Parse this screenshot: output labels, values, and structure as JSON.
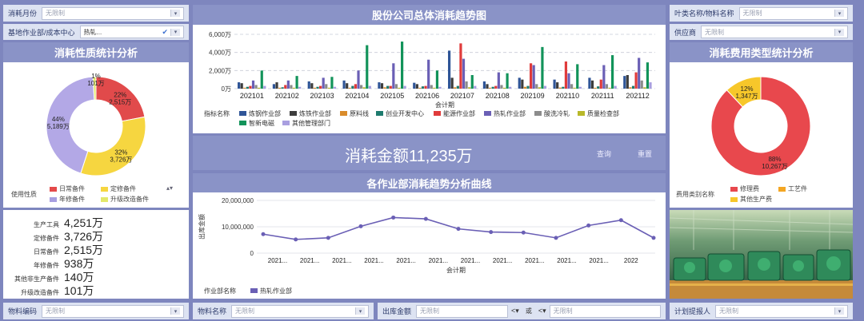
{
  "colors": {
    "accent": "#8a93c7",
    "background": "#7e86be"
  },
  "filters": {
    "consume_month": {
      "label": "消耗月份",
      "value": "无限制"
    },
    "base_unit": {
      "label": "基地作业部/成本中心",
      "value": "热轧..."
    },
    "material_name": {
      "label": "叶类名称/物料名称",
      "value": "无限制"
    },
    "supplier": {
      "label": "供应商",
      "value": "无限制"
    },
    "material_code": {
      "label": "物料编码",
      "value": "无限制"
    },
    "material_desc": {
      "label": "物料名称",
      "value": "无限制"
    },
    "issue_amount": {
      "label": "出库金额",
      "value": "无限制",
      "op1": "<",
      "mid": "或",
      "op2": "<",
      "value2": "无限制"
    },
    "planner": {
      "label": "计划提报人",
      "value": "无限制"
    }
  },
  "left_panel": {
    "title": "消耗性质统计分析",
    "legend_label": "使用性质",
    "legend": [
      {
        "name": "日常备件",
        "color": "#e44a4a"
      },
      {
        "name": "定修备件",
        "color": "#f6d640"
      },
      {
        "name": "年修备件",
        "color": "#a79ee0"
      },
      {
        "name": "升级改造备件",
        "color": "#e3e86a"
      }
    ]
  },
  "donut_left": [
    {
      "name": "日常备件",
      "pct": "22%",
      "value": "2,515万",
      "share": 0.22,
      "color": "#e14a4b"
    },
    {
      "name": "定修备件",
      "pct": "32%",
      "value": "3,726万",
      "share": 0.33,
      "color": "#f6d640"
    },
    {
      "name": "年修备件",
      "pct": "44%",
      "value": "5,189万",
      "share": 0.44,
      "color": "#b3a8e6"
    },
    {
      "name": "升级改造备件",
      "pct": "1%",
      "value": "101万",
      "share": 0.01,
      "color": "#e3e86a"
    }
  ],
  "stats": [
    {
      "label": "生产工具",
      "value": "4,251万"
    },
    {
      "label": "定修备件",
      "value": "3,726万"
    },
    {
      "label": "日常备件",
      "value": "2,515万"
    },
    {
      "label": "年修备件",
      "value": "938万"
    },
    {
      "label": "其他非生产备件",
      "value": "140万"
    },
    {
      "label": "升级改造备件",
      "value": "101万"
    }
  ],
  "center_top": {
    "title": "股份公司总体消耗趋势图",
    "xlabel": "会计期",
    "legend_label": "指标名称"
  },
  "chart_data": [
    {
      "type": "bar",
      "title": "股份公司总体消耗趋势图",
      "xlabel": "会计期",
      "ylabel": "",
      "y_ticks": [
        "6,000万",
        "4,000万",
        "2,000万",
        "0万"
      ],
      "ylim": [
        0,
        6000
      ],
      "categories": [
        "202101",
        "202102",
        "202103",
        "202104",
        "202105",
        "202106",
        "202107",
        "202108",
        "202109",
        "202110",
        "202111",
        "202112"
      ],
      "series": [
        {
          "name": "炼钢作业部",
          "color": "#2f5597",
          "values": [
            700,
            500,
            800,
            900,
            700,
            650,
            4200,
            800,
            1200,
            1000,
            1200,
            1400
          ]
        },
        {
          "name": "炼铁作业部",
          "color": "#3d3d3d",
          "values": [
            600,
            700,
            600,
            600,
            600,
            500,
            1200,
            500,
            1000,
            700,
            900,
            1500
          ]
        },
        {
          "name": "原料线",
          "color": "#d98b2b",
          "values": [
            100,
            100,
            100,
            100,
            150,
            100,
            150,
            100,
            200,
            120,
            100,
            150
          ]
        },
        {
          "name": "创业开发中心",
          "color": "#1e7b6e",
          "values": [
            200,
            150,
            200,
            300,
            300,
            250,
            300,
            200,
            300,
            200,
            250,
            300
          ]
        },
        {
          "name": "能源作业部",
          "color": "#e03b3b",
          "values": [
            300,
            400,
            300,
            500,
            300,
            300,
            5000,
            300,
            2800,
            3000,
            1000,
            1800
          ]
        },
        {
          "name": "热轧作业部",
          "color": "#6a5fb5",
          "values": [
            900,
            900,
            1200,
            2000,
            2800,
            3200,
            3300,
            1800,
            2600,
            1700,
            2600,
            3400
          ]
        },
        {
          "name": "酸洗冷轧",
          "color": "#8c8c8c",
          "values": [
            400,
            400,
            500,
            400,
            500,
            400,
            800,
            400,
            500,
            500,
            500,
            900
          ]
        },
        {
          "name": "质量检查部",
          "color": "#b8b82a",
          "values": [
            100,
            100,
            100,
            150,
            100,
            100,
            150,
            100,
            150,
            100,
            100,
            150
          ]
        },
        {
          "name": "智新电磁",
          "color": "#12935a",
          "values": [
            2000,
            1400,
            1300,
            4800,
            5200,
            2000,
            1500,
            1700,
            4600,
            2700,
            3700,
            2900
          ]
        },
        {
          "name": "其他管理部门",
          "color": "#a99fe0",
          "values": [
            300,
            200,
            200,
            300,
            300,
            200,
            300,
            200,
            300,
            200,
            300,
            700
          ]
        }
      ]
    },
    {
      "type": "line",
      "title": "各作业部消耗趋势分析曲线",
      "xlabel": "会计期",
      "ylabel": "出库金额",
      "y_ticks": [
        "20,000,000",
        "10,000,000",
        "0"
      ],
      "ylim": [
        0,
        20000000
      ],
      "categories": [
        "2021...",
        "2021...",
        "2021...",
        "2021...",
        "2021...",
        "2021...",
        "2021...",
        "2021...",
        "2021...",
        "2021...",
        "2021...",
        "2022"
      ],
      "series": [
        {
          "name": "热轧作业部",
          "color": "#6a5fb5",
          "values": [
            7200000,
            5200000,
            5800000,
            10200000,
            13500000,
            13000000,
            9200000,
            8000000,
            7800000,
            5800000,
            10500000,
            12500000,
            5800000
          ]
        }
      ]
    },
    {
      "type": "pie",
      "title": "消耗费用类型统计分析",
      "legend_label": "费用类别名称",
      "slices": [
        {
          "name": "修理费",
          "pct": "88%",
          "value": "10,267万",
          "share": 0.88,
          "color": "#e8484d"
        },
        {
          "name": "工艺件",
          "pct": "",
          "value": "",
          "share": 0.0,
          "color": "#f4a623"
        },
        {
          "name": "其他生产费",
          "pct": "12%",
          "value": "1,347万",
          "share": 0.12,
          "color": "#f7c72a"
        }
      ]
    }
  ],
  "total": {
    "label": "消耗金额11,235万",
    "query": "查询",
    "reset": "重置"
  },
  "center_mid": {
    "title": "各作业部消耗趋势分析曲线",
    "legend_label": "作业部名称",
    "series_name": "热轧作业部"
  },
  "right_panel": {
    "title": "消耗费用类型统计分析",
    "legend_label": "费用类别名称",
    "legend": [
      {
        "name": "修理费",
        "color": "#e8484d"
      },
      {
        "name": "工艺件",
        "color": "#f4a623"
      },
      {
        "name": "其他生产费",
        "color": "#f7c72a"
      }
    ]
  }
}
